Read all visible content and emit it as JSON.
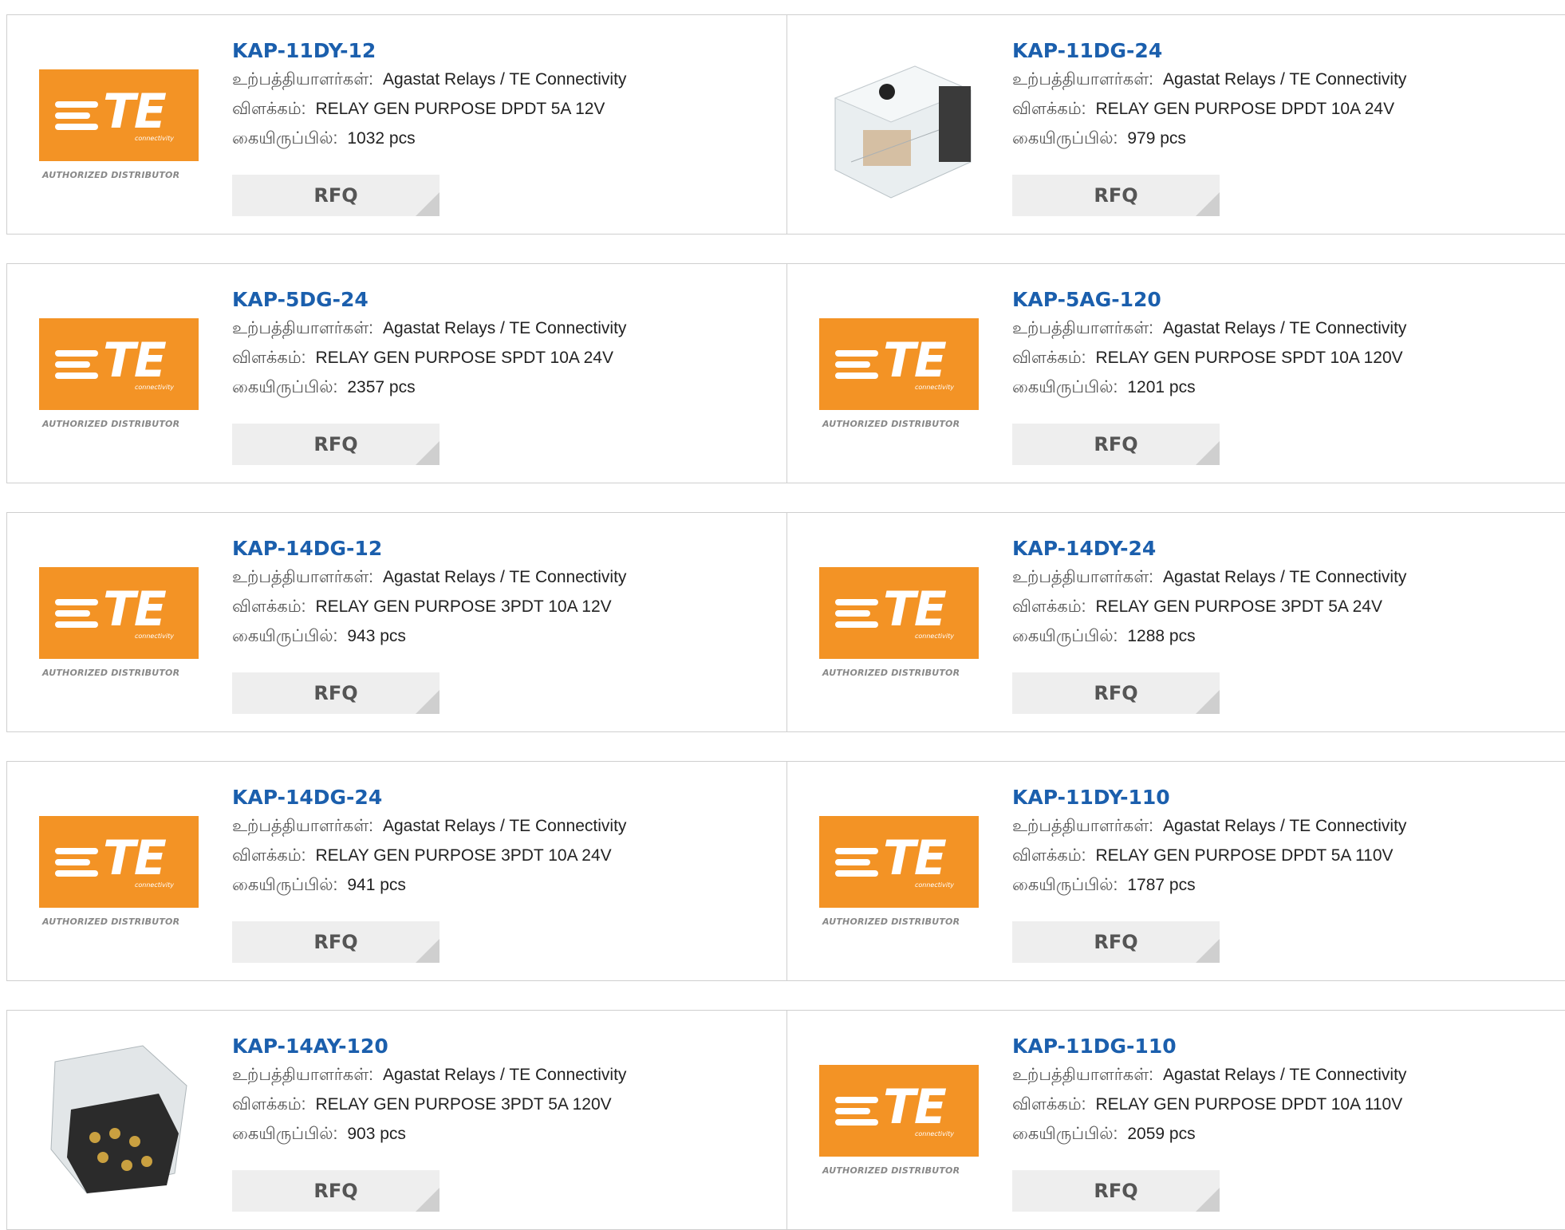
{
  "labels": {
    "manufacturer": "உற்பத்தியாளர்கள்:",
    "description": "விளக்கம்:",
    "stock": "கையிருப்பில்:",
    "rfq": "RFQ"
  },
  "te_logo": {
    "wordmark": "TE",
    "tagline": "connectivity",
    "authorized": "AUTHORIZED DISTRIBUTOR"
  },
  "colors": {
    "link": "#1b5fad",
    "brand_orange": "#f39325",
    "button_bg": "#eeeeee"
  },
  "products": [
    {
      "part": "KAP-11DY-12",
      "manufacturer": "Agastat Relays / TE Connectivity",
      "description": "RELAY GEN PURPOSE DPDT 5A 12V",
      "stock": "1032 pcs",
      "image": "te-logo"
    },
    {
      "part": "KAP-11DG-24",
      "manufacturer": "Agastat Relays / TE Connectivity",
      "description": "RELAY GEN PURPOSE DPDT 10A 24V",
      "stock": "979 pcs",
      "image": "relay-photo-side"
    },
    {
      "part": "KAP-5DG-24",
      "manufacturer": "Agastat Relays / TE Connectivity",
      "description": "RELAY GEN PURPOSE SPDT 10A 24V",
      "stock": "2357 pcs",
      "image": "te-logo"
    },
    {
      "part": "KAP-5AG-120",
      "manufacturer": "Agastat Relays / TE Connectivity",
      "description": "RELAY GEN PURPOSE SPDT 10A 120V",
      "stock": "1201 pcs",
      "image": "te-logo"
    },
    {
      "part": "KAP-14DG-12",
      "manufacturer": "Agastat Relays / TE Connectivity",
      "description": "RELAY GEN PURPOSE 3PDT 10A 12V",
      "stock": "943 pcs",
      "image": "te-logo"
    },
    {
      "part": "KAP-14DY-24",
      "manufacturer": "Agastat Relays / TE Connectivity",
      "description": "RELAY GEN PURPOSE 3PDT 5A 24V",
      "stock": "1288 pcs",
      "image": "te-logo"
    },
    {
      "part": "KAP-14DG-24",
      "manufacturer": "Agastat Relays / TE Connectivity",
      "description": "RELAY GEN PURPOSE 3PDT 10A 24V",
      "stock": "941 pcs",
      "image": "te-logo"
    },
    {
      "part": "KAP-11DY-110",
      "manufacturer": "Agastat Relays / TE Connectivity",
      "description": "RELAY GEN PURPOSE DPDT 5A 110V",
      "stock": "1787 pcs",
      "image": "te-logo"
    },
    {
      "part": "KAP-14AY-120",
      "manufacturer": "Agastat Relays / TE Connectivity",
      "description": "RELAY GEN PURPOSE 3PDT 5A 120V",
      "stock": "903 pcs",
      "image": "relay-photo-pins"
    },
    {
      "part": "KAP-11DG-110",
      "manufacturer": "Agastat Relays / TE Connectivity",
      "description": "RELAY GEN PURPOSE DPDT 10A 110V",
      "stock": "2059 pcs",
      "image": "te-logo"
    }
  ]
}
